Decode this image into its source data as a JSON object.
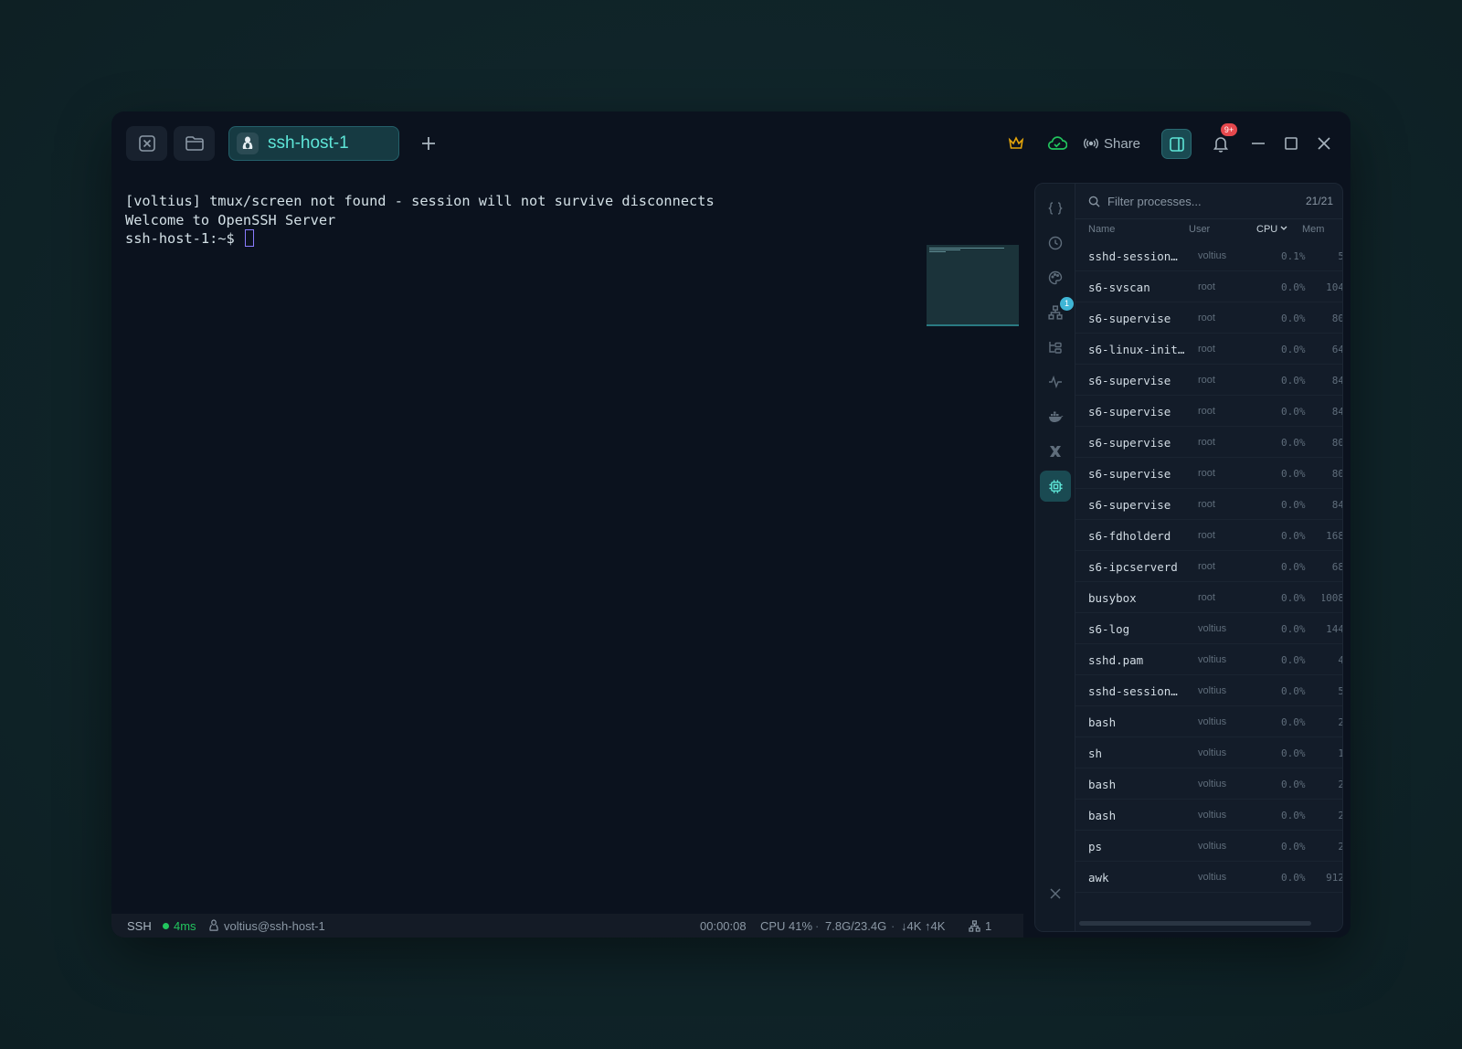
{
  "titlebar": {
    "tab_title": "ssh-host-1",
    "share_label": "Share",
    "notification_badge": "9+"
  },
  "terminal": {
    "lines": [
      "[voltius] tmux/screen not found - session will not survive disconnects",
      "Welcome to OpenSSH Server",
      "ssh-host-1:~$ "
    ]
  },
  "statusbar": {
    "protocol": "SSH",
    "latency": "4ms",
    "user_host": "voltius@ssh-host-1",
    "uptime": "00:00:08",
    "cpu": "CPU 41%",
    "mem": "7.8G/23.4G",
    "net": "↓4K ↑4K",
    "sessions": "1"
  },
  "panel": {
    "rail_badge": "1",
    "filter_placeholder": "Filter processes...",
    "count": "21/21",
    "columns": {
      "name": "Name",
      "user": "User",
      "cpu": "CPU",
      "mem": "Mem"
    },
    "processes": [
      {
        "name": "sshd-session…",
        "user": "voltius",
        "cpu": "0.1%",
        "mem": "5"
      },
      {
        "name": "s6-svscan",
        "user": "root",
        "cpu": "0.0%",
        "mem": "104"
      },
      {
        "name": "s6-supervise",
        "user": "root",
        "cpu": "0.0%",
        "mem": "80"
      },
      {
        "name": "s6-linux-init…",
        "user": "root",
        "cpu": "0.0%",
        "mem": "64"
      },
      {
        "name": "s6-supervise",
        "user": "root",
        "cpu": "0.0%",
        "mem": "84"
      },
      {
        "name": "s6-supervise",
        "user": "root",
        "cpu": "0.0%",
        "mem": "84"
      },
      {
        "name": "s6-supervise",
        "user": "root",
        "cpu": "0.0%",
        "mem": "80"
      },
      {
        "name": "s6-supervise",
        "user": "root",
        "cpu": "0.0%",
        "mem": "80"
      },
      {
        "name": "s6-supervise",
        "user": "root",
        "cpu": "0.0%",
        "mem": "84"
      },
      {
        "name": "s6-fdholderd",
        "user": "root",
        "cpu": "0.0%",
        "mem": "168"
      },
      {
        "name": "s6-ipcserverd",
        "user": "root",
        "cpu": "0.0%",
        "mem": "68"
      },
      {
        "name": "busybox",
        "user": "root",
        "cpu": "0.0%",
        "mem": "1008"
      },
      {
        "name": "s6-log",
        "user": "voltius",
        "cpu": "0.0%",
        "mem": "144"
      },
      {
        "name": "sshd.pam",
        "user": "voltius",
        "cpu": "0.0%",
        "mem": "4"
      },
      {
        "name": "sshd-session…",
        "user": "voltius",
        "cpu": "0.0%",
        "mem": "5"
      },
      {
        "name": "bash",
        "user": "voltius",
        "cpu": "0.0%",
        "mem": "2"
      },
      {
        "name": "sh",
        "user": "voltius",
        "cpu": "0.0%",
        "mem": "1"
      },
      {
        "name": "bash",
        "user": "voltius",
        "cpu": "0.0%",
        "mem": "2"
      },
      {
        "name": "bash",
        "user": "voltius",
        "cpu": "0.0%",
        "mem": "2"
      },
      {
        "name": "ps",
        "user": "voltius",
        "cpu": "0.0%",
        "mem": "2"
      },
      {
        "name": "awk",
        "user": "voltius",
        "cpu": "0.0%",
        "mem": "912"
      }
    ]
  },
  "colors": {
    "accent": "#5ee6d8",
    "crown": "#e5a50a",
    "cloud": "#22c55e",
    "badge": "#e5484d"
  }
}
